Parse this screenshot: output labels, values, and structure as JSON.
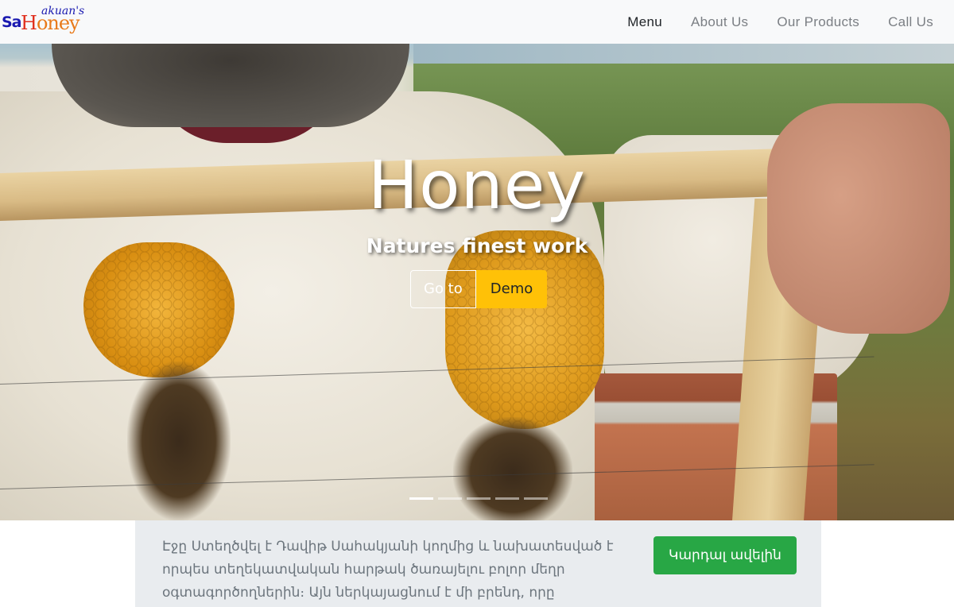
{
  "brand": {
    "logo_sa": "Sa",
    "logo_honey_h": "H",
    "logo_honey_rest": "oney",
    "logo_akuan": "akuan's"
  },
  "nav": {
    "items": [
      {
        "label": "Menu",
        "active": true
      },
      {
        "label": "About Us",
        "active": false
      },
      {
        "label": "Our Products",
        "active": false
      },
      {
        "label": "Call Us",
        "active": false
      }
    ]
  },
  "hero": {
    "title": "Honey",
    "subtitle": "Natures finest work",
    "button_goto": "Go to",
    "button_demo": "Demo",
    "slide_count": 5,
    "active_slide": 1
  },
  "info": {
    "text": "Էջը Ստեղծվել է Դավիթ Սահակյանի կողմից և նախատեսված է որպես տեղեկատվական հարթակ ծառայելու բոլոր մեղր օգտագործողներին։ Այն ներկայացնում է մի բրենդ, որը",
    "button_label": "Կարդալ ավելին"
  },
  "colors": {
    "navbar_bg": "#f8f9fa",
    "warning": "#ffc107",
    "success": "#28a745",
    "info_bg": "#e9ecef"
  }
}
